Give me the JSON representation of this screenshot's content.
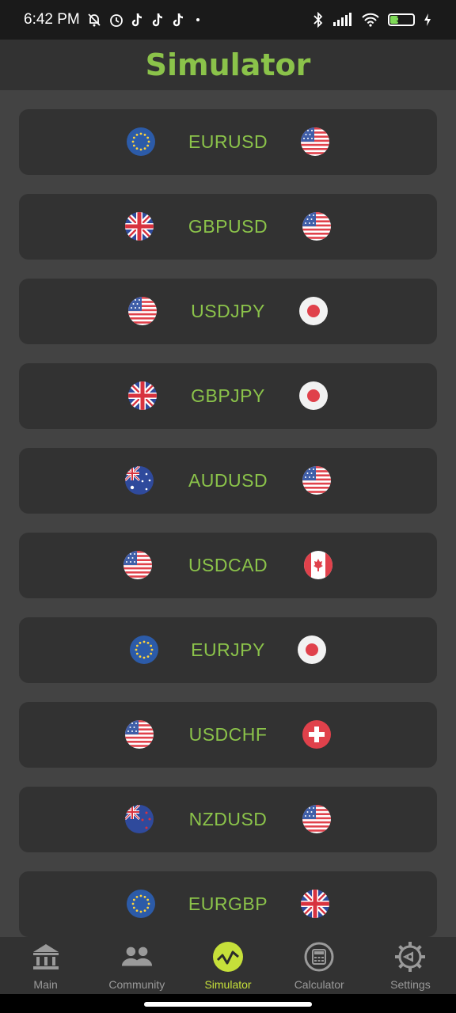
{
  "status_bar": {
    "time": "6:42 PM",
    "battery_level": "35",
    "icons_left": [
      "bell-off-icon",
      "alarm-icon",
      "tiktok-icon",
      "tiktok-icon",
      "tiktok-icon",
      "dot-icon"
    ],
    "icons_right": [
      "bluetooth-icon",
      "signal-icon",
      "wifi-icon",
      "battery-icon",
      "charging-icon"
    ]
  },
  "app_bar": {
    "title": "Simulator"
  },
  "pairs": [
    {
      "label": "EURUSD",
      "base_flag": "eu",
      "quote_flag": "us"
    },
    {
      "label": "GBPUSD",
      "base_flag": "gb",
      "quote_flag": "us"
    },
    {
      "label": "USDJPY",
      "base_flag": "us",
      "quote_flag": "jp"
    },
    {
      "label": "GBPJPY",
      "base_flag": "gb",
      "quote_flag": "jp"
    },
    {
      "label": "AUDUSD",
      "base_flag": "au",
      "quote_flag": "us"
    },
    {
      "label": "USDCAD",
      "base_flag": "us",
      "quote_flag": "ca"
    },
    {
      "label": "EURJPY",
      "base_flag": "eu",
      "quote_flag": "jp"
    },
    {
      "label": "USDCHF",
      "base_flag": "us",
      "quote_flag": "ch"
    },
    {
      "label": "NZDUSD",
      "base_flag": "nz",
      "quote_flag": "us"
    },
    {
      "label": "EURGBP",
      "base_flag": "eu",
      "quote_flag": "gb"
    }
  ],
  "bottom_nav": {
    "items": [
      {
        "label": "Main",
        "icon": "bank-icon"
      },
      {
        "label": "Community",
        "icon": "people-icon"
      },
      {
        "label": "Simulator",
        "icon": "chart-icon",
        "active": true
      },
      {
        "label": "Calculator",
        "icon": "calculator-icon"
      },
      {
        "label": "Settings",
        "icon": "gear-icon"
      }
    ]
  },
  "colors": {
    "accent": "#8bc34a",
    "active_nav": "#c6e03a",
    "card": "#323232",
    "background": "#434343"
  }
}
